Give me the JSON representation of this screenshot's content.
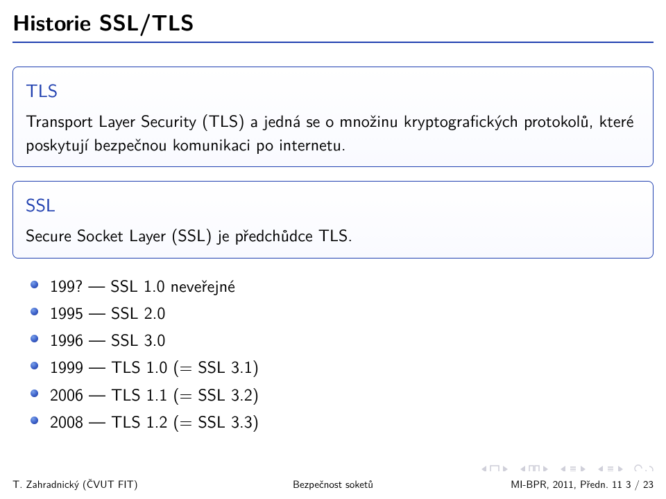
{
  "title": "Historie SSL/TLS",
  "blocks": {
    "tls": {
      "heading": "TLS",
      "body": "Transport Layer Security (TLS) a jedná se o množinu kryptografických protokolů, které poskytují bezpečnou komunikaci po internetu."
    },
    "ssl": {
      "heading": "SSL",
      "body": "Secure Socket Layer (SSL) je předchůdce TLS."
    }
  },
  "bullets": [
    "199?  —  SSL 1.0 neveřejné",
    "1995 — SSL 2.0",
    "1996 — SSL 3.0",
    "1999 — TLS 1.0 (= SSL 3.1)",
    "2006 — TLS 1.1 (= SSL 3.2)",
    "2008 — TLS 1.2 (= SSL 3.3)"
  ],
  "footer": {
    "author": "T. Zahradnický (ČVUT FIT)",
    "center": "Bezpečnost soketů",
    "right": "MI-BPR, 2011, Předn. 11    3 / 23"
  },
  "colors": {
    "accent": "#2040b0"
  }
}
